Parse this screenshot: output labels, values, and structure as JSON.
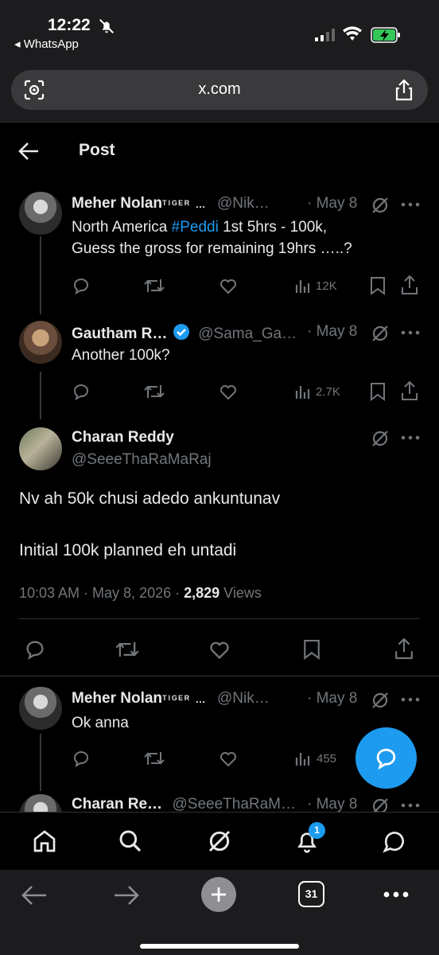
{
  "status_bar": {
    "time": "12:22",
    "back_app": "◂ WhatsApp"
  },
  "browser": {
    "url": "x.com",
    "tab_count": "31"
  },
  "header": {
    "title": "Post"
  },
  "tweets": [
    {
      "name": "Meher Nolan",
      "name_suffix": "ᵀᴵᴳᴱᴿ …",
      "handle": "@Nik…",
      "date": "· May 8",
      "text_pre": "North America ",
      "hashtag": "#Peddi",
      "text_post": " 1st 5hrs - 100k,",
      "text_line2": "Guess the gross for remaining 19hrs …..?",
      "views": "12K"
    },
    {
      "name": "Gautham R…",
      "handle": "@Sama_Ga…",
      "date": "· May 8",
      "text": "Another 100k?",
      "views": "2.7K"
    }
  ],
  "main_post": {
    "name": "Charan Reddy",
    "handle": "@SeeeThaRaMaRaj",
    "line1": "Nv ah 50k chusi adedo ankuntunav",
    "line2": "Initial 100k planned eh untadi",
    "timestamp": "10:03 AM · May 8, 2026 · ",
    "views_count": "2,829",
    "views_label": " Views"
  },
  "replies": [
    {
      "name": "Meher Nolan",
      "name_suffix": "ᵀᴵᴳᴱᴿ …",
      "handle": "@Nik…",
      "date": "· May 8",
      "text": "Ok anna",
      "views": "455"
    },
    {
      "name": "Charan Re…",
      "handle": "@SeeeThaRaM…",
      "date": "· May 8"
    }
  ],
  "tabbar": {
    "notifications_badge": "1"
  },
  "colors": {
    "accent": "#1d9bf0",
    "muted": "#71767b",
    "background": "#000000"
  },
  "icons": [
    "back-arrow-icon",
    "grok-icon",
    "more-icon",
    "reply-icon",
    "retweet-icon",
    "like-icon",
    "views-icon",
    "bookmark-icon",
    "share-icon",
    "home-icon",
    "search-icon",
    "notifications-icon",
    "messages-icon",
    "compose-icon"
  ]
}
